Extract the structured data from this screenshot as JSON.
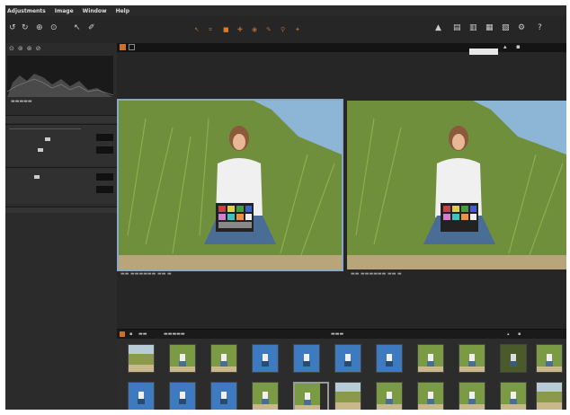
{
  "menubar": {
    "items": [
      "Adjustments",
      "Image",
      "Window",
      "Help"
    ]
  },
  "toolbar": {
    "left_icons": [
      "undo-icon",
      "redo-icon",
      "import-icon",
      "export-icon",
      "cursor-icon",
      "brush-icon"
    ],
    "center_tools": [
      "pointer-tool",
      "crop-tool",
      "straighten-tool",
      "retouch-tool",
      "redeye-tool",
      "mask-tool",
      "wb-picker-tool",
      "eyedropper-tool"
    ],
    "right_icons": [
      "warning-icon",
      "print-icon",
      "compare-icon",
      "share-icon",
      "export2-icon",
      "settings-icon",
      "help-icon"
    ]
  },
  "left_panel": {
    "tab_icons": [
      "library-icon",
      "folder-icon",
      "adjust-icon",
      "meta-icon"
    ]
  },
  "viewer": {},
  "browser": {
    "thumbnails_row1": [
      "grass",
      "girl",
      "girl",
      "blue",
      "blue",
      "blue",
      "blue",
      "girl",
      "girl",
      "dark-girl",
      "girl"
    ],
    "thumbnails_row2": [
      "blue",
      "blue",
      "blue",
      "girl",
      "girl-sel",
      "grass",
      "girl",
      "girl",
      "girl",
      "girl",
      "grass"
    ]
  },
  "colors": {
    "bg": "#1c1c1c",
    "panel": "#2b2b2b",
    "accent": "#d07020",
    "selection": "#8aa8c8"
  }
}
